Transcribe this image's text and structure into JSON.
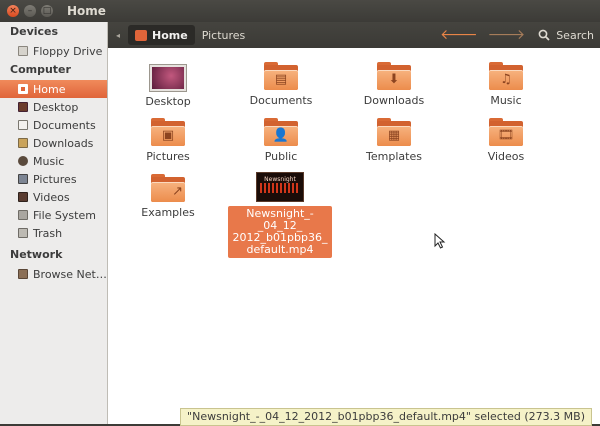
{
  "window": {
    "title": "Home"
  },
  "sidebar": {
    "sections": [
      {
        "title": "Devices",
        "items": [
          {
            "label": "Floppy Drive",
            "icon": "floppy-icon"
          }
        ]
      },
      {
        "title": "Computer",
        "items": [
          {
            "label": "Home",
            "icon": "home-icon",
            "active": true
          },
          {
            "label": "Desktop",
            "icon": "desktop-icon"
          },
          {
            "label": "Documents",
            "icon": "documents-icon"
          },
          {
            "label": "Downloads",
            "icon": "downloads-icon"
          },
          {
            "label": "Music",
            "icon": "music-icon"
          },
          {
            "label": "Pictures",
            "icon": "pictures-icon"
          },
          {
            "label": "Videos",
            "icon": "videos-icon"
          },
          {
            "label": "File System",
            "icon": "filesystem-icon"
          },
          {
            "label": "Trash",
            "icon": "trash-icon"
          }
        ]
      },
      {
        "title": "Network",
        "items": [
          {
            "label": "Browse Net…",
            "icon": "network-icon"
          }
        ]
      }
    ]
  },
  "toolbar": {
    "breadcrumbs": [
      {
        "label": "Home",
        "active": true
      },
      {
        "label": "Pictures"
      }
    ],
    "search_label": "Search"
  },
  "files": [
    {
      "label": "Desktop",
      "kind": "desktop",
      "icon": "desktop-folder-icon"
    },
    {
      "label": "Documents",
      "kind": "folder",
      "icon": "documents-folder-icon"
    },
    {
      "label": "Downloads",
      "kind": "folder",
      "icon": "downloads-folder-icon"
    },
    {
      "label": "Music",
      "kind": "folder",
      "icon": "music-folder-icon"
    },
    {
      "label": "Pictures",
      "kind": "folder",
      "icon": "pictures-folder-icon"
    },
    {
      "label": "Public",
      "kind": "folder",
      "icon": "public-folder-icon"
    },
    {
      "label": "Templates",
      "kind": "folder",
      "icon": "templates-folder-icon"
    },
    {
      "label": "Videos",
      "kind": "folder",
      "icon": "videos-folder-icon"
    },
    {
      "label": "Examples",
      "kind": "folder",
      "icon": "examples-folder-icon"
    }
  ],
  "selected_file": {
    "label": "Newsnight_-_04_12_2012_b01pbp36_default.mp4",
    "label_lines": [
      "Newsnight_-_04_12_",
      "2012_b01pbp36_",
      "default.mp4"
    ],
    "thumb_text": "Newsnight"
  },
  "status": {
    "text": "\"Newsnight_-_04_12_2012_b01pbp36_default.mp4\" selected (273.3 MB)"
  },
  "colors": {
    "accent": "#e0653a",
    "folder": "#ec8c4c",
    "titlebar": "#3c3b37"
  }
}
